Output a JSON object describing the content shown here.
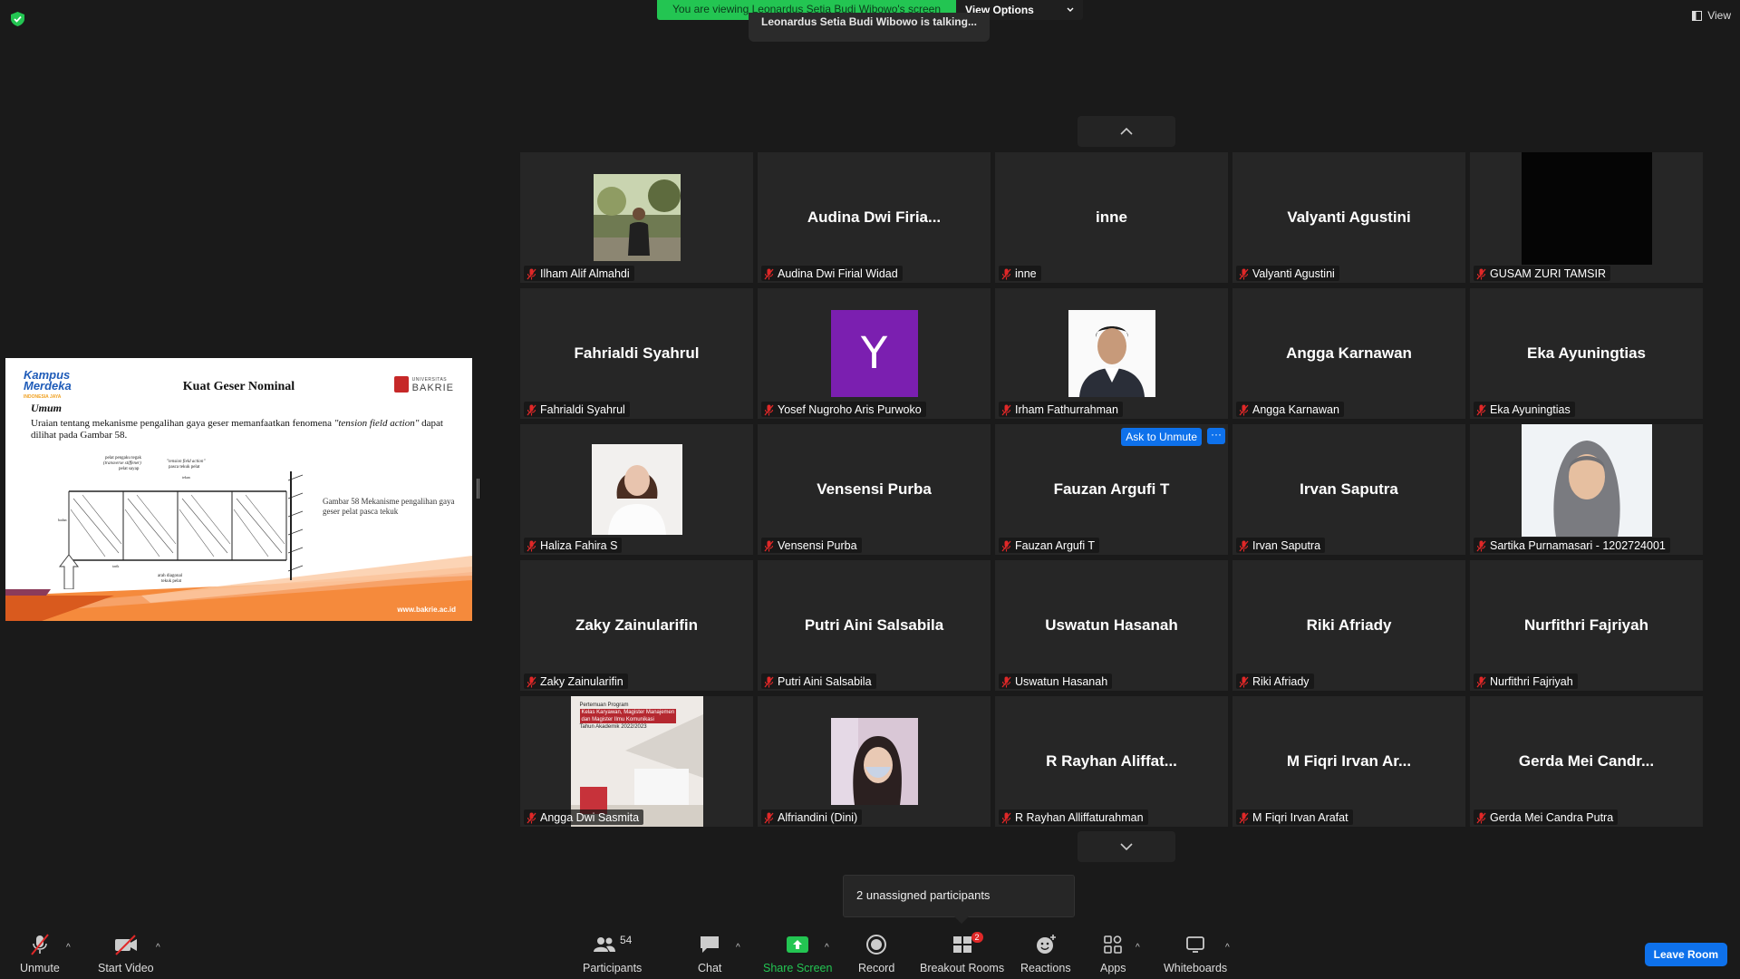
{
  "banner": {
    "viewing_text": "You are viewing Leonardus Setia Budi Wibowo's screen",
    "view_options": "View Options",
    "talking": "Leonardus Setia Budi Wibowo is talking..."
  },
  "top_right": {
    "view_label": "View"
  },
  "slide": {
    "logo_kampus": "Kampus",
    "logo_merdeka": "Merdeka",
    "logo_sub": "INDONESIA JAYA",
    "title": "Kuat Geser Nominal",
    "logo_univ_small": "UNIVERSITAS",
    "logo_univ": "BAKRIE",
    "section": "Umum",
    "paragraph_a": "Uraian tentang mekanisme pengalihan gaya geser memanfaatkan fenomena ",
    "paragraph_em": "\"tension field action\"",
    "paragraph_b": " dapat dilihat pada Gambar 58.",
    "caption": "Gambar 58 Mekanisme pengalihan gaya geser pelat pasca tekuk",
    "diagram_labels": {
      "l1": "pelat pengaku tegak",
      "l2": "(transverse stiffener)",
      "l3": "pelat sayap",
      "l4": "\"tension field action\"",
      "l5": "pasca tekuk pelat",
      "l6": "tekan",
      "l7": "badan",
      "l8": "tarik",
      "l9": "arah diagonal",
      "l10": "tekuk pelat"
    },
    "url": "www.bakrie.ac.id"
  },
  "gallery": {
    "tiles": [
      {
        "label": "Ilham Alif Almahdi",
        "display": "",
        "photo": "person-outdoor"
      },
      {
        "label": "Audina Dwi Firial Widad",
        "display": "Audina Dwi Firia..."
      },
      {
        "label": "inne",
        "display": "inne"
      },
      {
        "label": "Valyanti Agustini",
        "display": "Valyanti Agustini"
      },
      {
        "label": "GUSAM ZURI TAMSIR",
        "display": "",
        "photo": "black"
      },
      {
        "label": "Fahrialdi Syahrul",
        "display": "Fahrialdi Syahrul"
      },
      {
        "label": "Yosef Nugroho Aris Purwoko",
        "display": "",
        "avatar_letter": "Y"
      },
      {
        "label": "Irham Fathurrahman",
        "display": "",
        "photo": "man-formal"
      },
      {
        "label": "Angga Karnawan",
        "display": "Angga Karnawan"
      },
      {
        "label": "Eka Ayuningtias",
        "display": "Eka Ayuningtias"
      },
      {
        "label": "Haliza Fahira S",
        "display": "",
        "photo": "woman-white"
      },
      {
        "label": "Vensensi Purba",
        "display": "Vensensi Purba"
      },
      {
        "label": "Fauzan Argufi T",
        "display": "Fauzan Argufi T"
      },
      {
        "label": "Irvan Saputra",
        "display": "Irvan Saputra"
      },
      {
        "label": "Sartika Purnamasari - 1202724001",
        "display": "",
        "photo": "woman-hijab"
      },
      {
        "label": "Zaky Zainularifin",
        "display": "Zaky Zainularifin"
      },
      {
        "label": "Putri Aini Salsabila",
        "display": "Putri Aini Salsabila"
      },
      {
        "label": "Uswatun Hasanah",
        "display": "Uswatun Hasanah"
      },
      {
        "label": "Riki Afriady",
        "display": "Riki Afriady"
      },
      {
        "label": "Nurfithri Fajriyah",
        "display": "Nurfithri Fajriyah"
      },
      {
        "label": "Angga Dwi Sasmita",
        "display": "",
        "photo": "room-poster"
      },
      {
        "label": "Alfriandini (Dini)",
        "display": "",
        "photo": "woman-mask"
      },
      {
        "label": "R Rayhan Alliffaturahman",
        "display": "R Rayhan Aliffat..."
      },
      {
        "label": "M Fiqri Irvan Arafat",
        "display": "M Fiqri Irvan Ar..."
      },
      {
        "label": "Gerda Mei Candra Putra",
        "display": "Gerda Mei Candr..."
      }
    ],
    "ask_unmute": "Ask to Unmute",
    "more": "···"
  },
  "poster": {
    "l1": "Pertemuan Program",
    "l2": "Kelas Karyawan, Magister Manajemen",
    "l3": "dan Magister Ilmu Komunikasi",
    "l4": "Tahun Akademik 2022/2023"
  },
  "unassigned": "2 unassigned participants",
  "toolbar": {
    "unmute": "Unmute",
    "start_video": "Start Video",
    "participants": "Participants",
    "participants_count": "54",
    "chat": "Chat",
    "share_screen": "Share Screen",
    "record": "Record",
    "breakout_rooms": "Breakout Rooms",
    "breakout_badge": "2",
    "reactions": "Reactions",
    "apps": "Apps",
    "whiteboards": "Whiteboards",
    "leave_room": "Leave Room"
  },
  "colors": {
    "accent": "#0e71eb",
    "share_green": "#23c552",
    "banner_green": "#23c552",
    "mic_red": "#e02828",
    "avatar_purple": "#7b1fb0"
  }
}
